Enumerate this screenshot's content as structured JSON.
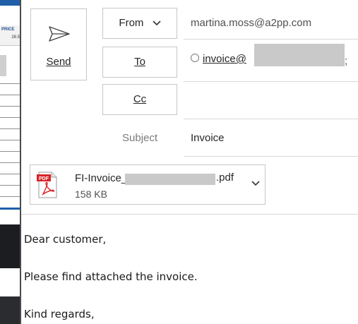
{
  "background_app": {
    "column_header": "PRICE",
    "cell_value": "28.5"
  },
  "compose": {
    "send_label": "Send",
    "from_label": "From",
    "to_label": "To",
    "cc_label": "Cc",
    "subject_label": "Subject",
    "from_address": "martina.moss@a2pp.com",
    "to_recipient_visible": "invoice@",
    "to_recipient_suffix": ";",
    "subject_value": "Invoice",
    "attachment": {
      "name_prefix": "FI-Invoice_",
      "name_suffix": ".pdf",
      "size": "158 KB",
      "icon": "pdf-icon"
    },
    "body_lines": [
      "Dear customer,",
      "Please find attached the invoice.",
      "Kind regards,"
    ]
  },
  "colors": {
    "window_border": "#4a4a4a",
    "button_border": "#c6c6c6",
    "pdf_red": "#d9252a",
    "redaction": "#c9c9c9"
  }
}
